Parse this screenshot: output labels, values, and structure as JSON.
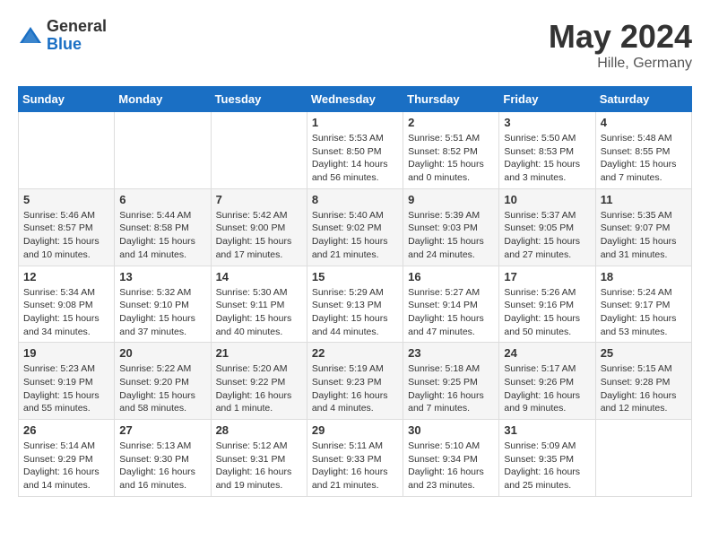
{
  "header": {
    "logo_general": "General",
    "logo_blue": "Blue",
    "month": "May 2024",
    "location": "Hille, Germany"
  },
  "weekdays": [
    "Sunday",
    "Monday",
    "Tuesday",
    "Wednesday",
    "Thursday",
    "Friday",
    "Saturday"
  ],
  "weeks": [
    [
      {
        "day": "",
        "info": ""
      },
      {
        "day": "",
        "info": ""
      },
      {
        "day": "",
        "info": ""
      },
      {
        "day": "1",
        "info": "Sunrise: 5:53 AM\nSunset: 8:50 PM\nDaylight: 14 hours\nand 56 minutes."
      },
      {
        "day": "2",
        "info": "Sunrise: 5:51 AM\nSunset: 8:52 PM\nDaylight: 15 hours\nand 0 minutes."
      },
      {
        "day": "3",
        "info": "Sunrise: 5:50 AM\nSunset: 8:53 PM\nDaylight: 15 hours\nand 3 minutes."
      },
      {
        "day": "4",
        "info": "Sunrise: 5:48 AM\nSunset: 8:55 PM\nDaylight: 15 hours\nand 7 minutes."
      }
    ],
    [
      {
        "day": "5",
        "info": "Sunrise: 5:46 AM\nSunset: 8:57 PM\nDaylight: 15 hours\nand 10 minutes."
      },
      {
        "day": "6",
        "info": "Sunrise: 5:44 AM\nSunset: 8:58 PM\nDaylight: 15 hours\nand 14 minutes."
      },
      {
        "day": "7",
        "info": "Sunrise: 5:42 AM\nSunset: 9:00 PM\nDaylight: 15 hours\nand 17 minutes."
      },
      {
        "day": "8",
        "info": "Sunrise: 5:40 AM\nSunset: 9:02 PM\nDaylight: 15 hours\nand 21 minutes."
      },
      {
        "day": "9",
        "info": "Sunrise: 5:39 AM\nSunset: 9:03 PM\nDaylight: 15 hours\nand 24 minutes."
      },
      {
        "day": "10",
        "info": "Sunrise: 5:37 AM\nSunset: 9:05 PM\nDaylight: 15 hours\nand 27 minutes."
      },
      {
        "day": "11",
        "info": "Sunrise: 5:35 AM\nSunset: 9:07 PM\nDaylight: 15 hours\nand 31 minutes."
      }
    ],
    [
      {
        "day": "12",
        "info": "Sunrise: 5:34 AM\nSunset: 9:08 PM\nDaylight: 15 hours\nand 34 minutes."
      },
      {
        "day": "13",
        "info": "Sunrise: 5:32 AM\nSunset: 9:10 PM\nDaylight: 15 hours\nand 37 minutes."
      },
      {
        "day": "14",
        "info": "Sunrise: 5:30 AM\nSunset: 9:11 PM\nDaylight: 15 hours\nand 40 minutes."
      },
      {
        "day": "15",
        "info": "Sunrise: 5:29 AM\nSunset: 9:13 PM\nDaylight: 15 hours\nand 44 minutes."
      },
      {
        "day": "16",
        "info": "Sunrise: 5:27 AM\nSunset: 9:14 PM\nDaylight: 15 hours\nand 47 minutes."
      },
      {
        "day": "17",
        "info": "Sunrise: 5:26 AM\nSunset: 9:16 PM\nDaylight: 15 hours\nand 50 minutes."
      },
      {
        "day": "18",
        "info": "Sunrise: 5:24 AM\nSunset: 9:17 PM\nDaylight: 15 hours\nand 53 minutes."
      }
    ],
    [
      {
        "day": "19",
        "info": "Sunrise: 5:23 AM\nSunset: 9:19 PM\nDaylight: 15 hours\nand 55 minutes."
      },
      {
        "day": "20",
        "info": "Sunrise: 5:22 AM\nSunset: 9:20 PM\nDaylight: 15 hours\nand 58 minutes."
      },
      {
        "day": "21",
        "info": "Sunrise: 5:20 AM\nSunset: 9:22 PM\nDaylight: 16 hours\nand 1 minute."
      },
      {
        "day": "22",
        "info": "Sunrise: 5:19 AM\nSunset: 9:23 PM\nDaylight: 16 hours\nand 4 minutes."
      },
      {
        "day": "23",
        "info": "Sunrise: 5:18 AM\nSunset: 9:25 PM\nDaylight: 16 hours\nand 7 minutes."
      },
      {
        "day": "24",
        "info": "Sunrise: 5:17 AM\nSunset: 9:26 PM\nDaylight: 16 hours\nand 9 minutes."
      },
      {
        "day": "25",
        "info": "Sunrise: 5:15 AM\nSunset: 9:28 PM\nDaylight: 16 hours\nand 12 minutes."
      }
    ],
    [
      {
        "day": "26",
        "info": "Sunrise: 5:14 AM\nSunset: 9:29 PM\nDaylight: 16 hours\nand 14 minutes."
      },
      {
        "day": "27",
        "info": "Sunrise: 5:13 AM\nSunset: 9:30 PM\nDaylight: 16 hours\nand 16 minutes."
      },
      {
        "day": "28",
        "info": "Sunrise: 5:12 AM\nSunset: 9:31 PM\nDaylight: 16 hours\nand 19 minutes."
      },
      {
        "day": "29",
        "info": "Sunrise: 5:11 AM\nSunset: 9:33 PM\nDaylight: 16 hours\nand 21 minutes."
      },
      {
        "day": "30",
        "info": "Sunrise: 5:10 AM\nSunset: 9:34 PM\nDaylight: 16 hours\nand 23 minutes."
      },
      {
        "day": "31",
        "info": "Sunrise: 5:09 AM\nSunset: 9:35 PM\nDaylight: 16 hours\nand 25 minutes."
      },
      {
        "day": "",
        "info": ""
      }
    ]
  ]
}
